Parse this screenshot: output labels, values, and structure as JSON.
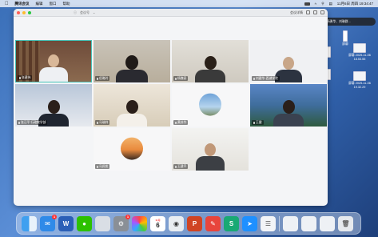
{
  "menubar": {
    "app_name": "腾讯会议",
    "menus": [
      "编辑",
      "窗口",
      "帮助"
    ],
    "clock": "11月6日 周四 19:34:47"
  },
  "meeting": {
    "title_left": "会议号",
    "title_right": "会议详情"
  },
  "notification": {
    "text": "正在讲话：杨勇华、刘琳群..."
  },
  "participants": [
    {
      "name": "张建伟"
    },
    {
      "name": "倪璐玲"
    },
    {
      "name": "杨魏豪"
    },
    {
      "name": "刘建华-西湖学院"
    },
    {
      "name": "张汪平 行政教学部"
    },
    {
      "name": "马瑞祥"
    },
    {
      "name": "黄苏华"
    },
    {
      "name": "王健"
    },
    {
      "name": "马润发"
    },
    {
      "name": "王建平"
    }
  ],
  "desktop_files": [
    {
      "label": "屏幕"
    },
    {
      "label": "屏幕 2025-11-06 18.53.55"
    },
    {
      "label": "屏幕 2025-11-06 19.32.29"
    }
  ],
  "dock": {
    "calendar_day": "6",
    "calendar_month": "11月",
    "badges": {
      "mail": "1",
      "settings": "1"
    }
  }
}
